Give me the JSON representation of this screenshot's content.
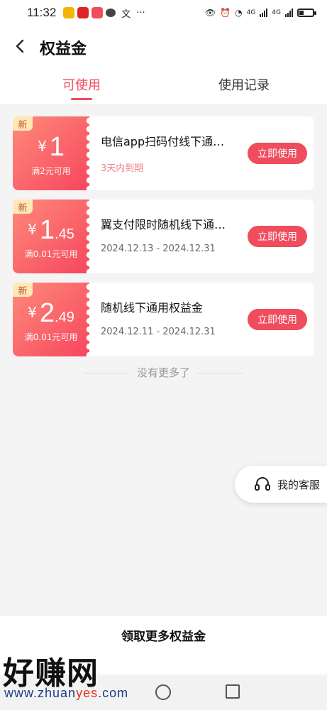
{
  "status_bar": {
    "time": "11:32",
    "extra_icon_text": "文",
    "network": "4G",
    "network2": "4G",
    "apps": [
      "#f4b400",
      "#e02424",
      "#ef4c5d"
    ]
  },
  "header": {
    "title": "权益金"
  },
  "tabs": [
    {
      "label": "可使用"
    },
    {
      "label": "使用记录"
    }
  ],
  "coupons": [
    {
      "badge": "新",
      "currency": "¥",
      "amount_int": "1",
      "amount_dec": "",
      "condition": "满2元可用",
      "title": "电信app扫码付线下通…",
      "subtitle": "3天内到期",
      "button": "立即使用"
    },
    {
      "badge": "新",
      "currency": "¥",
      "amount_int": "1",
      "amount_dec": ".45",
      "condition": "满0.01元可用",
      "title": "翼支付限时随机线下通…",
      "subtitle": "2024.12.13 - 2024.12.31",
      "button": "立即使用"
    },
    {
      "badge": "新",
      "currency": "¥",
      "amount_int": "2",
      "amount_dec": ".49",
      "condition": "满0.01元可用",
      "title": "随机线下通用权益金",
      "subtitle": "2024.12.11 - 2024.12.31",
      "button": "立即使用"
    }
  ],
  "no_more_text": "没有更多了",
  "service": {
    "label": "我的客服"
  },
  "bottom": {
    "more_label": "领取更多权益金"
  },
  "watermark": {
    "brand": "好赚网",
    "url_a": "www.zhuan",
    "url_b": "yes",
    "url_c": ".com"
  },
  "colors": {
    "accent": "#ef4c5d",
    "coupon_gradient_start": "#ff8a7a",
    "coupon_gradient_end": "#f6465e"
  }
}
